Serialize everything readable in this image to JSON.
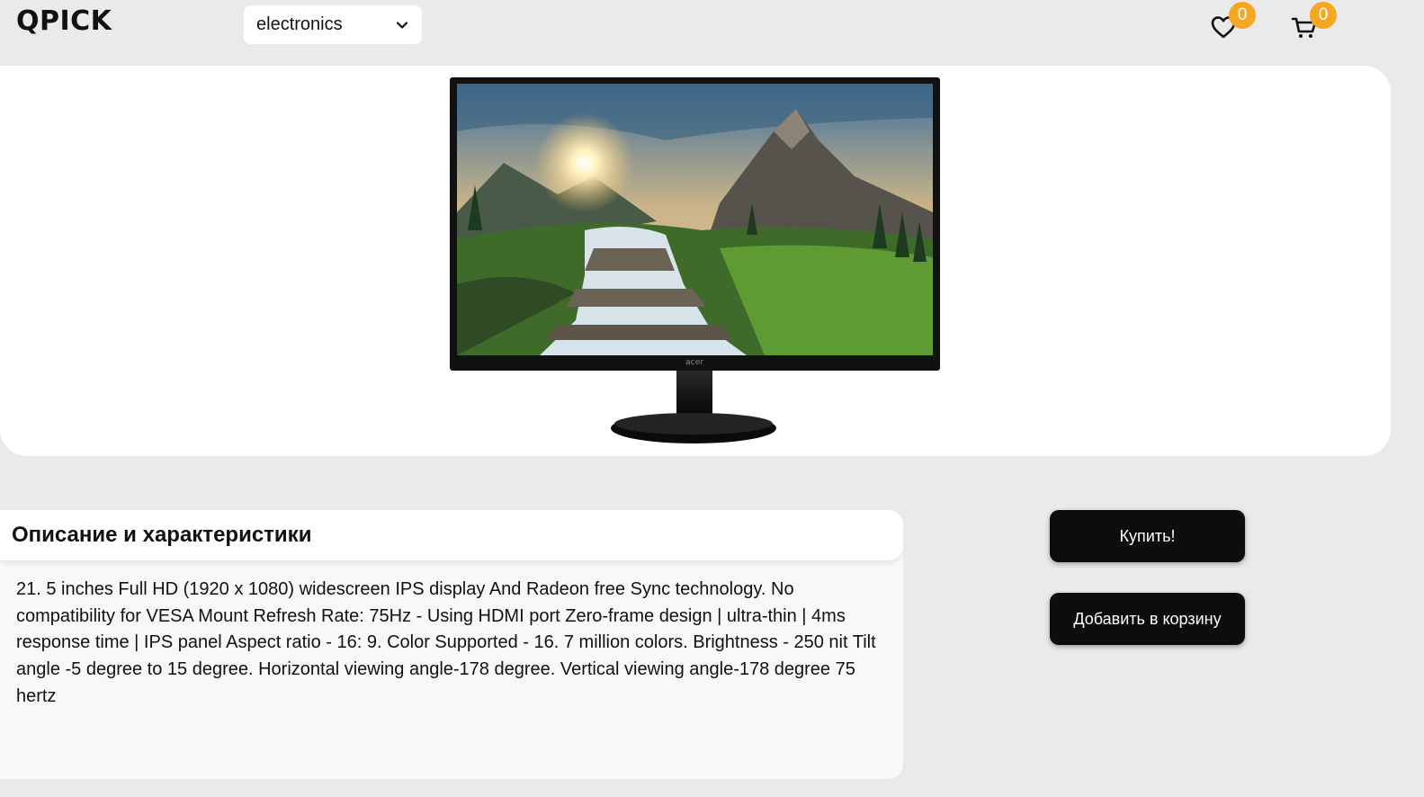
{
  "header": {
    "logo": "QPICK",
    "category_select": {
      "value": "electronics"
    },
    "favorites": {
      "icon": "heart-icon",
      "count": "0"
    },
    "cart": {
      "icon": "cart-icon",
      "count": "0"
    }
  },
  "product": {
    "image": {
      "brand_on_bezel": "acer",
      "icon": "monitor-image"
    },
    "description_title": "Описание и характеристики",
    "description": "21. 5 inches Full HD (1920 x 1080) widescreen IPS display And Radeon free Sync technology. No compatibility for VESA Mount Refresh Rate: 75Hz - Using HDMI port Zero-frame design | ultra-thin | 4ms response time | IPS panel Aspect ratio - 16: 9. Color Supported - 16. 7 million colors. Brightness - 250 nit Tilt angle -5 degree to 15 degree. Horizontal viewing angle-178 degree. Vertical viewing angle-178 degree 75 hertz"
  },
  "actions": {
    "buy_label": "Купить!",
    "add_to_cart_label": "Добавить в корзину"
  },
  "colors": {
    "background": "#eaeaea",
    "card": "#ffffff",
    "badge": "#f5a623",
    "button": "#0d0d0d"
  }
}
